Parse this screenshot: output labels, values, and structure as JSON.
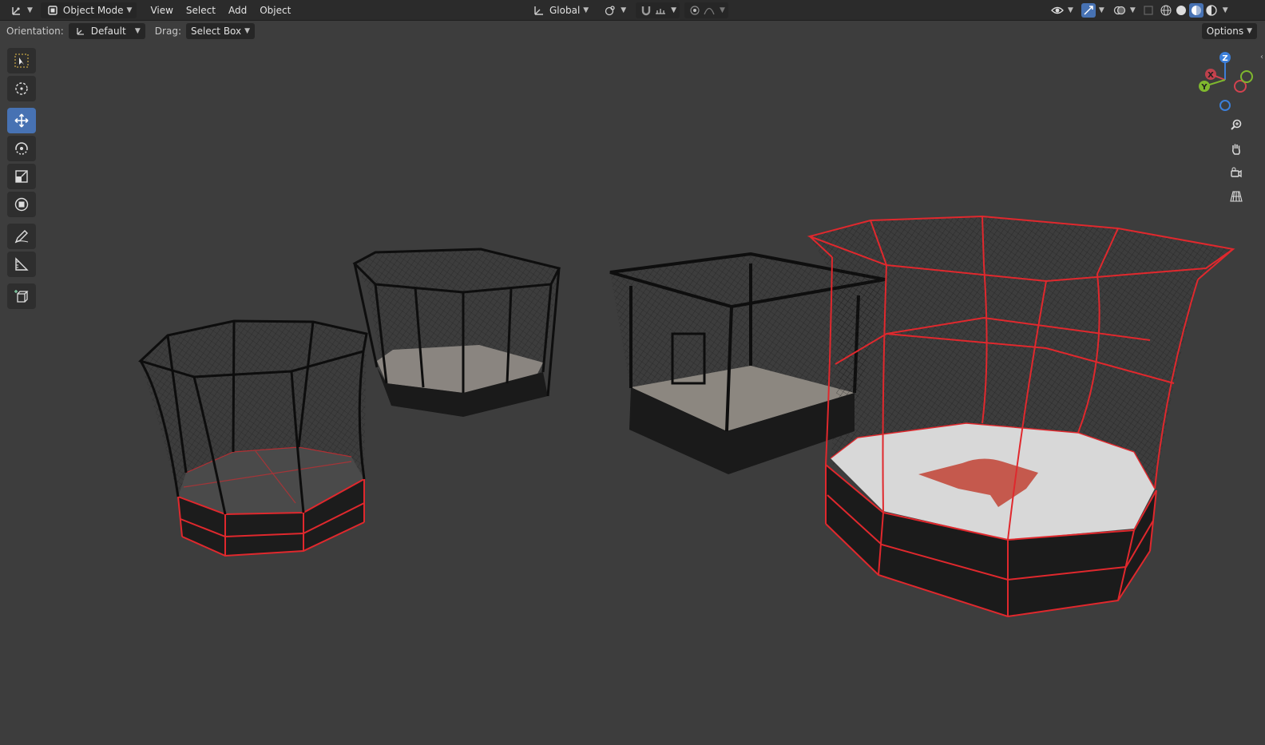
{
  "header": {
    "mode_label": "Object Mode",
    "menus": [
      "View",
      "Select",
      "Add",
      "Object"
    ],
    "transform_orientation": "Global",
    "options_label": "Options"
  },
  "tool_header": {
    "orientation_label": "Orientation:",
    "orientation_value": "Default",
    "drag_label": "Drag:",
    "drag_value": "Select Box"
  },
  "toolbar": {
    "tools": [
      "select-box",
      "cursor",
      "move",
      "rotate",
      "scale",
      "transform",
      "annotate",
      "measure",
      "add-cube"
    ],
    "active_tool": "move"
  },
  "gizmo": {
    "axes": [
      "X",
      "Y",
      "Z"
    ],
    "colors": {
      "x": "#d3424f",
      "y": "#7fb82e",
      "z": "#3c7fd9"
    }
  },
  "colors": {
    "accent": "#4772b3",
    "selection": "#e0282d",
    "viewport_bg": "#3d3d3d"
  }
}
